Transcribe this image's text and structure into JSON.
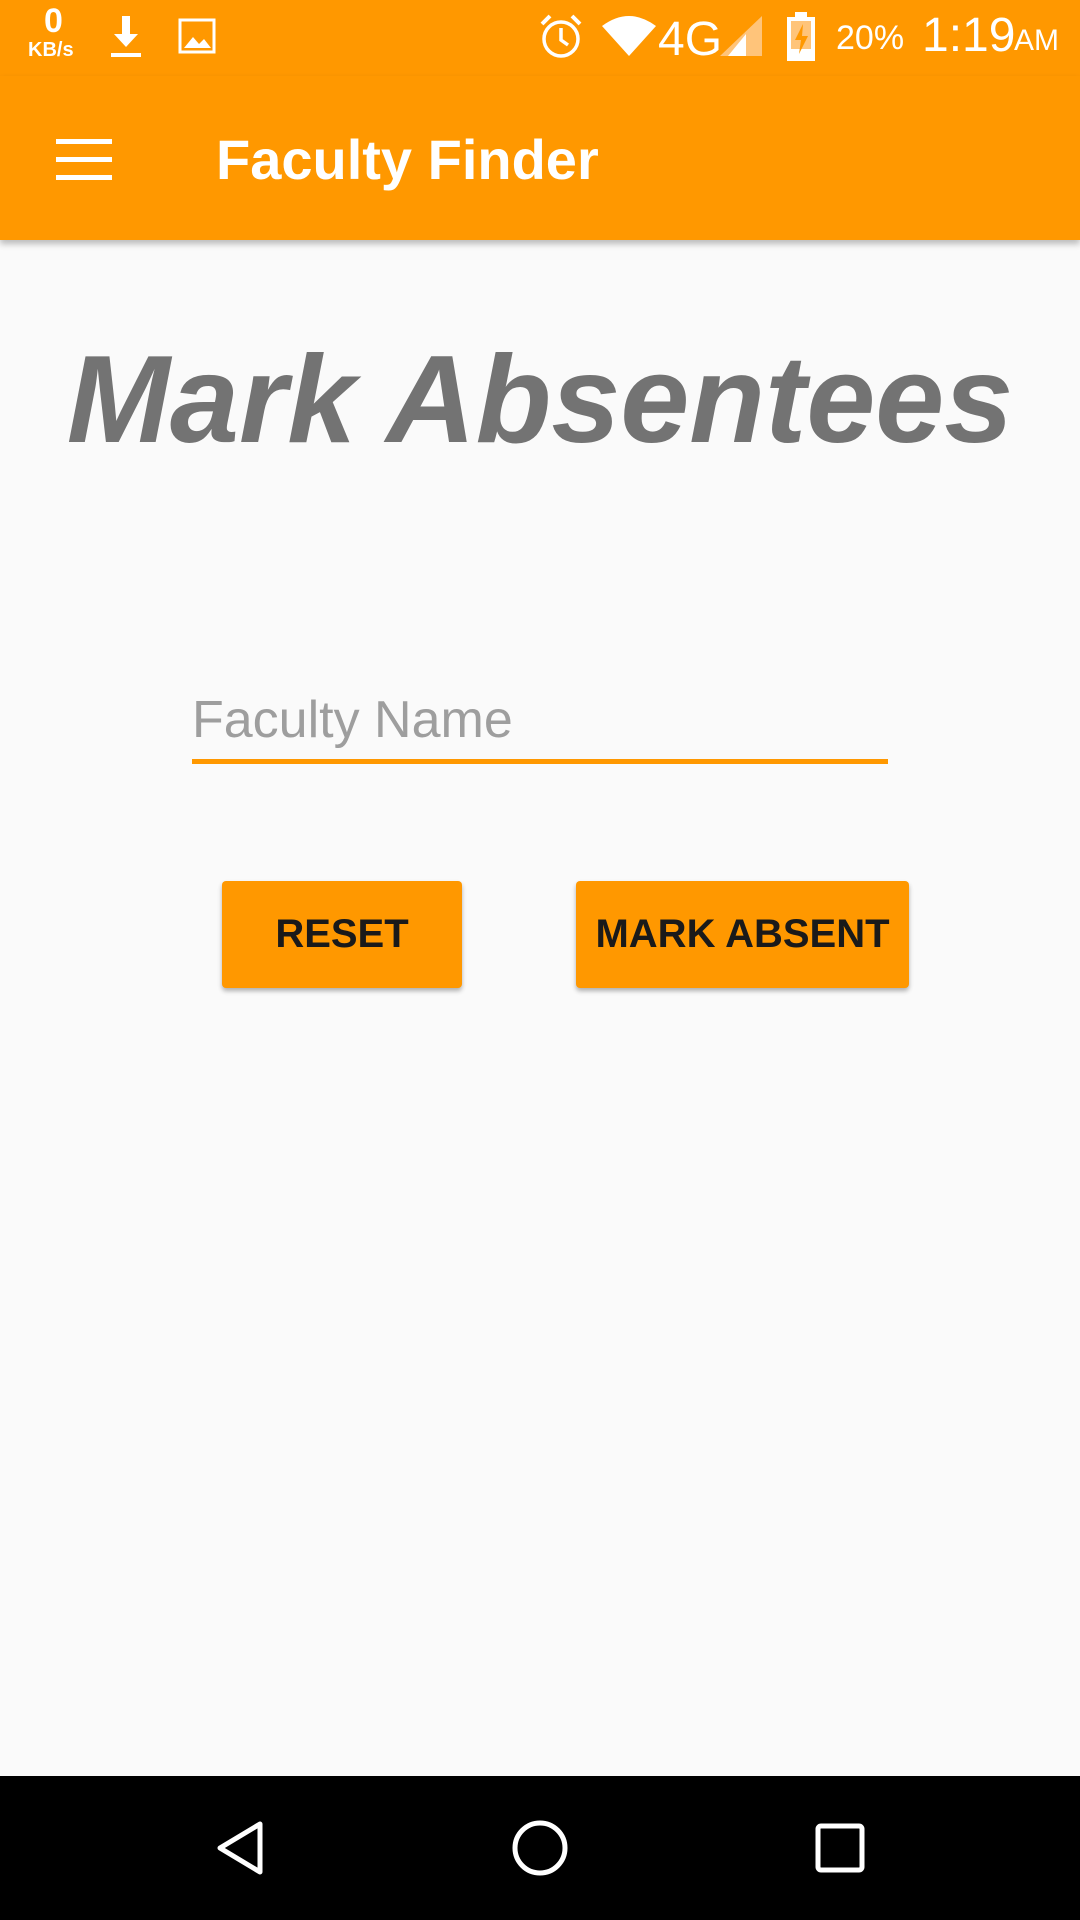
{
  "status_bar": {
    "net_speed_value": "0",
    "net_speed_unit": "KB/s",
    "network_type": "4G",
    "battery_percent": "20%",
    "time": "1:19",
    "time_suffix": "AM",
    "icons": [
      "download-icon",
      "image-icon",
      "alarm-icon",
      "wifi-icon",
      "signal-icon",
      "battery-charging-icon"
    ]
  },
  "app_bar": {
    "title": "Faculty Finder",
    "menu_icon": "hamburger-menu-icon"
  },
  "main": {
    "heading": "Mark Absentees",
    "faculty_name_input": {
      "value": "",
      "placeholder": "Faculty Name"
    },
    "reset_label": "RESET",
    "mark_absent_label": "MARK ABSENT"
  },
  "nav_bar": {
    "icons": [
      "back-icon",
      "home-icon",
      "recents-icon"
    ]
  },
  "colors": {
    "accent": "#ff9800",
    "heading": "#737373",
    "background": "#fafafa"
  }
}
